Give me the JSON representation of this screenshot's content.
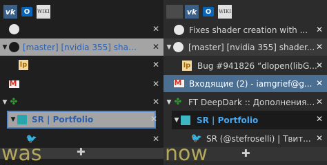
{
  "was": {
    "pinned_icons": [
      "vk-icon",
      "outlook-icon",
      "wikipedia-icon"
    ],
    "tabs": [
      {
        "title": "",
        "icon": "github-icon",
        "indent": 0,
        "twisty": ""
      },
      {
        "title": "[master] [nvidia 355] shader...",
        "icon": "github-icon",
        "indent": 0,
        "twisty": "▼"
      },
      {
        "title": "",
        "icon": "launchpad-icon",
        "indent": 1,
        "twisty": ""
      },
      {
        "title": "",
        "icon": "gmail-icon",
        "indent": 0,
        "twisty": ""
      },
      {
        "title": "",
        "icon": "addon-icon",
        "indent": 0,
        "twisty": "▼"
      },
      {
        "title": "SR | Portfolio",
        "icon": "sr-icon",
        "indent": 1,
        "twisty": "▼"
      },
      {
        "title": "",
        "icon": "twitter-icon",
        "indent": 2,
        "twisty": ""
      }
    ],
    "close_glyph": "✕",
    "label": "was",
    "new_tab": "✚"
  },
  "now": {
    "pinned_icons": [
      "vk-icon",
      "outlook-icon",
      "wikipedia-icon"
    ],
    "tabs": [
      {
        "title": "Fixes shader creation with ...",
        "icon": "github-icon",
        "indent": 0,
        "twisty": ""
      },
      {
        "title": "[master] [nvidia 355] shader...",
        "icon": "github-icon",
        "indent": 0,
        "twisty": "▼"
      },
      {
        "title": "Bug #941826 “dlopen(libG...",
        "icon": "launchpad-icon",
        "indent": 1,
        "twisty": ""
      },
      {
        "title": "Входящие (2) - iamgrief@g...",
        "icon": "gmail-icon",
        "indent": 0,
        "twisty": ""
      },
      {
        "title": "FT DeepDark :: Дополнения ...",
        "icon": "addon-icon",
        "indent": 0,
        "twisty": "▼"
      },
      {
        "title": "SR | Portfolio",
        "icon": "sr-icon",
        "indent": 1,
        "twisty": "▼"
      },
      {
        "title": "SR (@stefroselli) | Твит...",
        "icon": "twitter-icon",
        "indent": 2,
        "twisty": ""
      }
    ],
    "close_glyph": "✕",
    "label": "now",
    "new_tab": "✚"
  },
  "pinned_glyphs": {
    "vk": "vk",
    "outlook": "O",
    "wikipedia": "WIKI"
  },
  "colors": {
    "accent_blue": "#4a90d9",
    "selected_now": "#4a6f92",
    "hover_now": "#3d3d3d"
  }
}
